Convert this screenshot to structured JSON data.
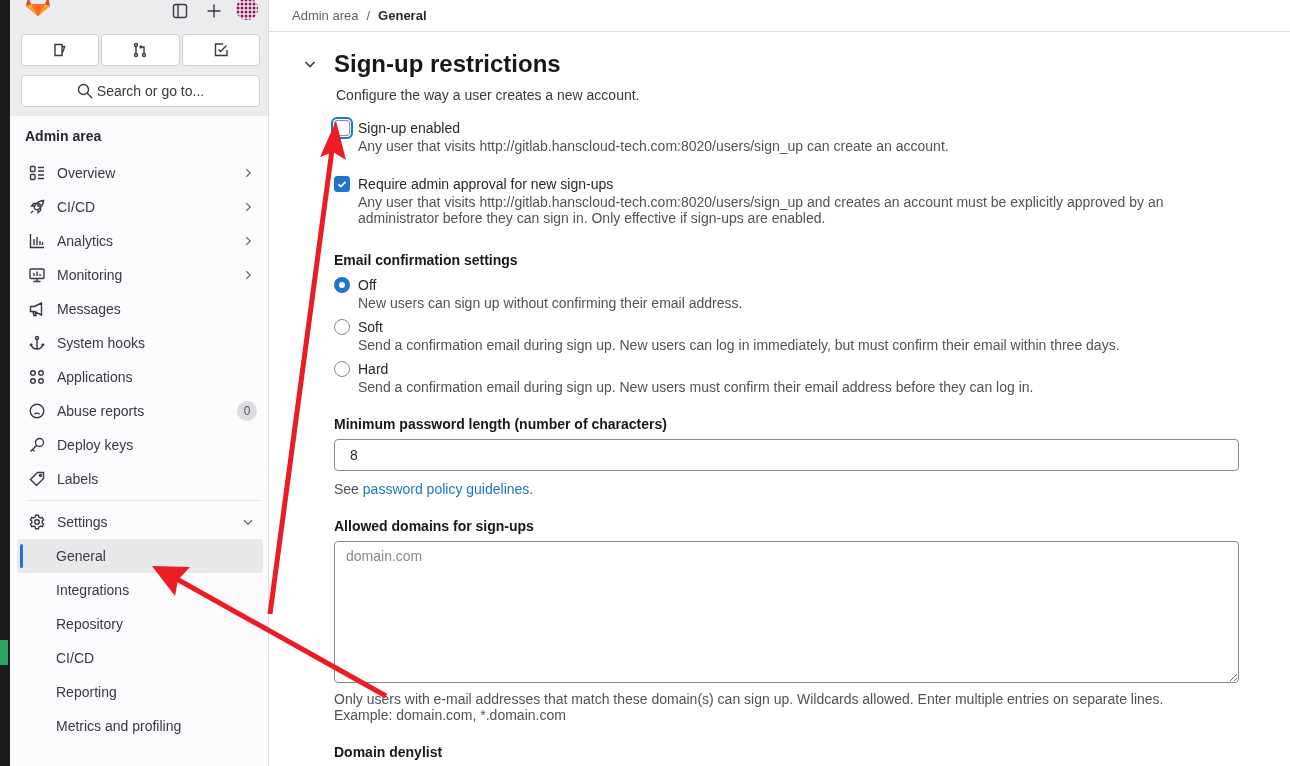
{
  "sidebar": {
    "search": {
      "placeholder": "Search or go to..."
    },
    "section_title": "Admin area",
    "items": [
      {
        "label": "Overview",
        "expanded": false
      },
      {
        "label": "CI/CD",
        "expanded": false
      },
      {
        "label": "Analytics",
        "expanded": false
      },
      {
        "label": "Monitoring",
        "expanded": false
      },
      {
        "label": "Messages"
      },
      {
        "label": "System hooks"
      },
      {
        "label": "Applications"
      },
      {
        "label": "Abuse reports",
        "badge": "0"
      },
      {
        "label": "Deploy keys"
      },
      {
        "label": "Labels"
      },
      {
        "label": "Settings",
        "expanded": true,
        "children": [
          {
            "label": "General",
            "selected": true
          },
          {
            "label": "Integrations",
            "selected": false
          },
          {
            "label": "Repository",
            "selected": false
          },
          {
            "label": "CI/CD",
            "selected": false
          },
          {
            "label": "Reporting",
            "selected": false
          },
          {
            "label": "Metrics and profiling",
            "selected": false
          }
        ]
      }
    ]
  },
  "breadcrumb": [
    "Admin area",
    "General"
  ],
  "breadcrumb_separator": "/",
  "section": {
    "title": "Sign-up restrictions",
    "expanded": true,
    "description": "Configure the way a user creates a new account.",
    "checkboxes": [
      {
        "label": "Sign-up enabled",
        "checked": false,
        "focused": true,
        "help": "Any user that visits http://gitlab.hanscloud-tech.com:8020/users/sign_up can create an account."
      },
      {
        "label": "Require admin approval for new sign-ups",
        "checked": true,
        "focused": false,
        "help": "Any user that visits http://gitlab.hanscloud-tech.com:8020/users/sign_up and creates an account must be explicitly approved by an administrator before they can sign in. Only effective if sign-ups are enabled."
      }
    ],
    "email_confirmation": {
      "label": "Email confirmation settings",
      "options": [
        {
          "label": "Off",
          "selected": true,
          "help": "New users can sign up without confirming their email address."
        },
        {
          "label": "Soft",
          "selected": false,
          "help": "Send a confirmation email during sign up. New users can log in immediately, but must confirm their email within three days."
        },
        {
          "label": "Hard",
          "selected": false,
          "help": "Send a confirmation email during sign up. New users must confirm their email address before they can log in."
        }
      ]
    },
    "min_password": {
      "label": "Minimum password length (number of characters)",
      "value": "8",
      "help_prefix": "See",
      "help_link": "password policy guidelines",
      "help_suffix": "."
    },
    "allowed_domains": {
      "label": "Allowed domains for sign-ups",
      "placeholder": "domain.com",
      "help": [
        "Only users with e-mail addresses that match these domain(s) can sign up. Wildcards allowed. Enter multiple entries on separate lines.",
        "Example: domain.com, *.domain.com"
      ]
    },
    "denylist": {
      "label": "Domain denylist"
    }
  }
}
